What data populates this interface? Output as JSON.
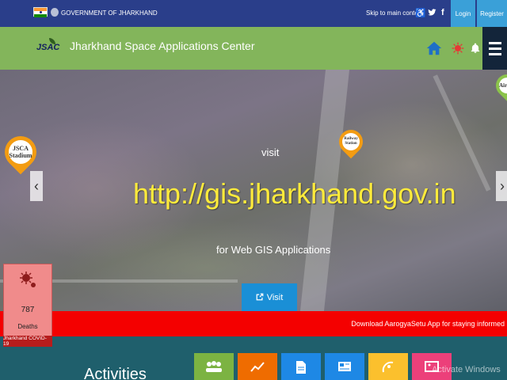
{
  "topbar": {
    "govt_label": "GOVERNMENT OF JHARKHAND",
    "skip_label": "Skip to main content",
    "login_label": "Login",
    "register_label": "Register"
  },
  "header": {
    "logo_text": "JSAC",
    "title": "Jharkhand Space Applications Center"
  },
  "hero": {
    "pins": [
      {
        "label_line1": "JSCA",
        "label_line2": "Stadium"
      },
      {
        "label_line1": "Railway",
        "label_line2": "Station"
      },
      {
        "label_line1": "Air"
      }
    ],
    "visit_word": "visit",
    "url": "http://gis.jharkhand.gov.in",
    "subtitle": "for Web GIS Applications",
    "visit_button": "Visit",
    "prev_arrow": "‹",
    "next_arrow": "›"
  },
  "ticker": {
    "text": "Download AarogyaSetu App for staying informed"
  },
  "covid": {
    "count": "787",
    "label": "Deaths",
    "footer": "Jharkhand COVID-19"
  },
  "bottom": {
    "section_title": "Activities",
    "watermark": "Activate Windows"
  },
  "colors": {
    "topbar": "#2a3e8a",
    "header": "#83b55b",
    "ticker": "#f40000",
    "url": "#ffeb3b",
    "button": "#1a8fd6",
    "tiles": [
      "#7cb342",
      "#ef6c00",
      "#1e88e5",
      "#1e88e5",
      "#fbc02d",
      "#ec407a"
    ]
  }
}
